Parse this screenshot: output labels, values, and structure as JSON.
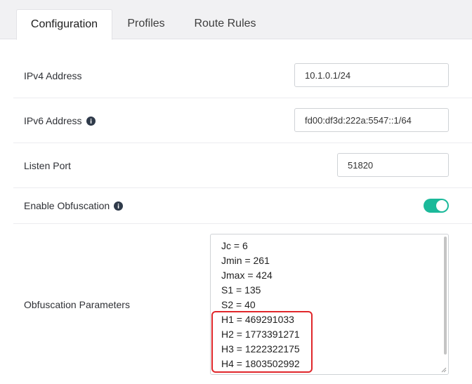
{
  "tabs": [
    {
      "label": "Configuration",
      "active": true
    },
    {
      "label": "Profiles",
      "active": false
    },
    {
      "label": "Route Rules",
      "active": false
    }
  ],
  "form": {
    "ipv4": {
      "label": "IPv4 Address",
      "value": "10.1.0.1/24"
    },
    "ipv6": {
      "label": "IPv6 Address",
      "value": "fd00:df3d:222a:5547::1/64",
      "icon": "info-icon"
    },
    "listen_port": {
      "label": "Listen Port",
      "value": "51820"
    },
    "obfuscation": {
      "label": "Enable Obfuscation",
      "enabled": true,
      "icon": "info-icon"
    },
    "obfuscation_params": {
      "label": "Obfuscation Parameters",
      "lines": [
        "Jc = 6",
        "Jmin = 261",
        "Jmax = 424",
        "S1 = 135",
        "S2 = 40",
        "H1 = 469291033",
        "H2 = 1773391271",
        "H3 = 1222322175",
        "H4 = 1803502992"
      ]
    }
  },
  "colors": {
    "toggle_on": "#1bb99a",
    "highlight": "#e0272b",
    "info_icon": "#2f3a4a"
  }
}
